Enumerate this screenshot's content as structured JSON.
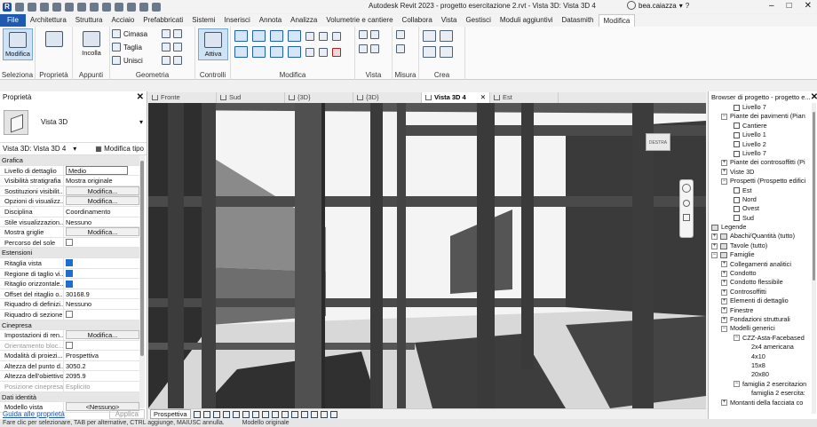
{
  "window": {
    "title": "Autodesk Revit 2023 - progetto esercitazione 2.rvt - Vista 3D: Vista 3D 4",
    "user": "bea.caiazza"
  },
  "menu": {
    "tabs": [
      "File",
      "Architettura",
      "Struttura",
      "Acciaio",
      "Prefabbricati",
      "Sistemi",
      "Inserisci",
      "Annota",
      "Analizza",
      "Volumetrie e cantiere",
      "Collabora",
      "Vista",
      "Gestisci",
      "Moduli aggiuntivi",
      "Datasmith",
      "Modifica"
    ],
    "active": "Modifica"
  },
  "ribbon": {
    "modifica_label": "Modifica",
    "seleziona_label": "Seleziona",
    "proprieta_label": "Proprietà",
    "incolla_label": "Incolla",
    "appunti_label": "Appunti",
    "cimasa": "Cimasa",
    "taglia": "Taglia",
    "unisci": "Unisci",
    "geometria_label": "Geometria",
    "attiva_label": "Attiva",
    "controlli_label": "Controlli",
    "modifica_group_label": "Modifica",
    "vista_label": "Vista",
    "misura_label": "Misura",
    "crea_label": "Crea"
  },
  "properties": {
    "title": "Proprietà",
    "type_name": "Vista 3D",
    "view_selector": "Vista 3D: Vista 3D 4",
    "edit_type": "Modifica tipo",
    "rows": [
      {
        "kind": "cat",
        "k": "Grafica"
      },
      {
        "kind": "input",
        "k": "Livello di dettaglio",
        "v": "Medio"
      },
      {
        "kind": "text",
        "k": "Visibilità stratigrafia",
        "v": "Mostra originale"
      },
      {
        "kind": "btn",
        "k": "Sostituzioni visibilit...",
        "v": "Modifica..."
      },
      {
        "kind": "btn",
        "k": "Opzioni di visualizz...",
        "v": "Modifica..."
      },
      {
        "kind": "text",
        "k": "Disciplina",
        "v": "Coordinamento"
      },
      {
        "kind": "text",
        "k": "Stile visualizzazion...",
        "v": "Nessuno"
      },
      {
        "kind": "btn",
        "k": "Mostra griglie",
        "v": "Modifica..."
      },
      {
        "kind": "chk",
        "k": "Percorso del sole",
        "v": "off"
      },
      {
        "kind": "cat",
        "k": "Estensioni"
      },
      {
        "kind": "chk",
        "k": "Ritaglia vista",
        "v": "on"
      },
      {
        "kind": "chk",
        "k": "Regione di taglio vi...",
        "v": "on"
      },
      {
        "kind": "chk",
        "k": "Ritaglio orizzontale...",
        "v": "on"
      },
      {
        "kind": "text",
        "k": "Offset del ritaglio o...",
        "v": "30168.9"
      },
      {
        "kind": "text",
        "k": "Riquadro di definizi...",
        "v": "Nessuno"
      },
      {
        "kind": "chk",
        "k": "Riquadro di sezione",
        "v": "off"
      },
      {
        "kind": "cat",
        "k": "Cinepresa"
      },
      {
        "kind": "btn",
        "k": "Impostazioni di ren...",
        "v": "Modifica..."
      },
      {
        "kind": "chkdim",
        "k": "Orientamento bloc...",
        "v": "off"
      },
      {
        "kind": "text",
        "k": "Modalità di proiezi...",
        "v": "Prospettiva"
      },
      {
        "kind": "text",
        "k": "Altezza del punto d...",
        "v": "3050.2"
      },
      {
        "kind": "text",
        "k": "Altezza dell'obiettivo",
        "v": "2095.9"
      },
      {
        "kind": "dim",
        "k": "Posizione cinepresa",
        "v": "Esplicito"
      },
      {
        "kind": "cat",
        "k": "Dati identità"
      },
      {
        "kind": "btn",
        "k": "Modello vista",
        "v": "<Nessuno>"
      }
    ],
    "help_link": "Guida alle proprietà",
    "apply": "Applica"
  },
  "view_tabs": [
    {
      "label": "Fronte",
      "active": false
    },
    {
      "label": "Sud",
      "active": false
    },
    {
      "label": "{3D}",
      "active": false
    },
    {
      "label": "{3D}",
      "active": false
    },
    {
      "label": "Vista 3D 4",
      "active": true
    },
    {
      "label": "Est",
      "active": false
    }
  ],
  "viewport": {
    "viewcube_label": "DESTRA",
    "bottom_label": "Prospettiva"
  },
  "browser": {
    "title": "Browser di progetto - progetto e...",
    "nodes": [
      {
        "indent": 28,
        "icon": "view",
        "label": "Livello 7"
      },
      {
        "indent": 14,
        "icon": "minus",
        "label": "Piante dei pavimenti (Pian"
      },
      {
        "indent": 28,
        "icon": "view",
        "label": "Cantiere"
      },
      {
        "indent": 28,
        "icon": "view",
        "label": "Livello 1"
      },
      {
        "indent": 28,
        "icon": "view",
        "label": "Livello 2"
      },
      {
        "indent": 28,
        "icon": "view",
        "label": "Livello 7"
      },
      {
        "indent": 14,
        "icon": "plus",
        "label": "Piante dei controsoffitti (Pi"
      },
      {
        "indent": 14,
        "icon": "plus",
        "label": "Viste 3D"
      },
      {
        "indent": 14,
        "icon": "minus",
        "label": "Prospetti (Prospetto edifici"
      },
      {
        "indent": 28,
        "icon": "view",
        "label": "Est"
      },
      {
        "indent": 28,
        "icon": "view",
        "label": "Nord"
      },
      {
        "indent": 28,
        "icon": "view",
        "label": "Ovest"
      },
      {
        "indent": 28,
        "icon": "view",
        "label": "Sud"
      },
      {
        "indent": 3,
        "icon": "group",
        "label": "Legende"
      },
      {
        "indent": 3,
        "icon": "plusgroup",
        "label": "Abachi/Quantità (tutto)"
      },
      {
        "indent": 3,
        "icon": "plusgroup",
        "label": "Tavole (tutto)"
      },
      {
        "indent": 3,
        "icon": "minusgroup",
        "label": "Famiglie"
      },
      {
        "indent": 14,
        "icon": "plus",
        "label": "Collegamenti analitici"
      },
      {
        "indent": 14,
        "icon": "plus",
        "label": "Condotto"
      },
      {
        "indent": 14,
        "icon": "plus",
        "label": "Condotto flessibile"
      },
      {
        "indent": 14,
        "icon": "plus",
        "label": "Controsoffitti"
      },
      {
        "indent": 14,
        "icon": "plus",
        "label": "Elementi di dettaglio"
      },
      {
        "indent": 14,
        "icon": "plus",
        "label": "Finestre"
      },
      {
        "indent": 14,
        "icon": "plus",
        "label": "Fondazioni strutturali"
      },
      {
        "indent": 14,
        "icon": "minus",
        "label": "Modelli generici"
      },
      {
        "indent": 28,
        "icon": "minus",
        "label": "CZZ-Asta-Facebased"
      },
      {
        "indent": 48,
        "icon": "none",
        "label": "2x4 americana"
      },
      {
        "indent": 48,
        "icon": "none",
        "label": "4x10"
      },
      {
        "indent": 48,
        "icon": "none",
        "label": "15x8"
      },
      {
        "indent": 48,
        "icon": "none",
        "label": "20x80"
      },
      {
        "indent": 28,
        "icon": "minus",
        "label": "famiglia 2 esercitazion"
      },
      {
        "indent": 48,
        "icon": "none",
        "label": "famiglia 2 esercita:"
      },
      {
        "indent": 14,
        "icon": "plus",
        "label": "Montanti della facciata co"
      }
    ]
  },
  "statusbar": {
    "items": [
      "Fare clic per selezionare, TAB per alternative, CTRL aggiunge, MAIUSC annulla.",
      "Modello originale"
    ]
  }
}
